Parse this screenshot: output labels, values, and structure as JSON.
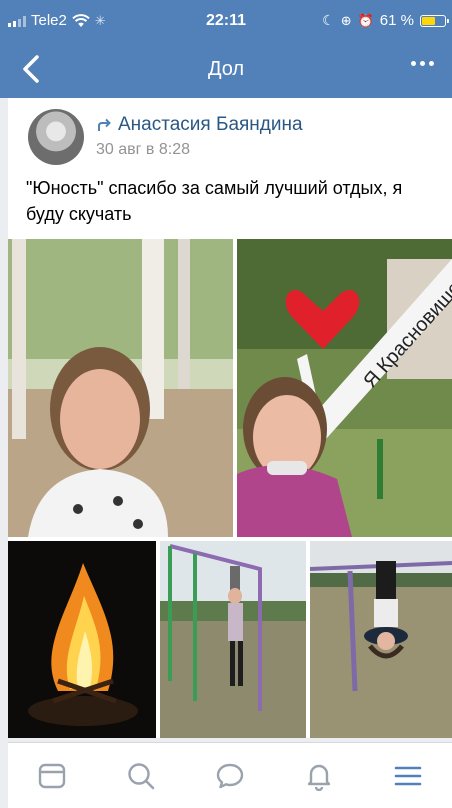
{
  "status_bar": {
    "carrier": "Tele2",
    "time": "22:11",
    "battery": "61 %",
    "battery_level": 0.61
  },
  "nav": {
    "title": "Дол"
  },
  "post": {
    "author": "Анастасия Баяндина",
    "date": "30 авг в 8:28",
    "text": "\"Юность\" спасибо за самый лучший отдых, я буду скучать",
    "sign_text": "Я Красновишерск"
  },
  "tabbar": {
    "icons": [
      "news-icon",
      "search-icon",
      "messages-icon",
      "notifications-icon",
      "menu-icon"
    ]
  },
  "colors": {
    "brand": "#5181b8",
    "link": "#2a5885",
    "muted": "#939393",
    "tab_active": "#5181b8",
    "tab_inactive": "#99a2ad"
  }
}
